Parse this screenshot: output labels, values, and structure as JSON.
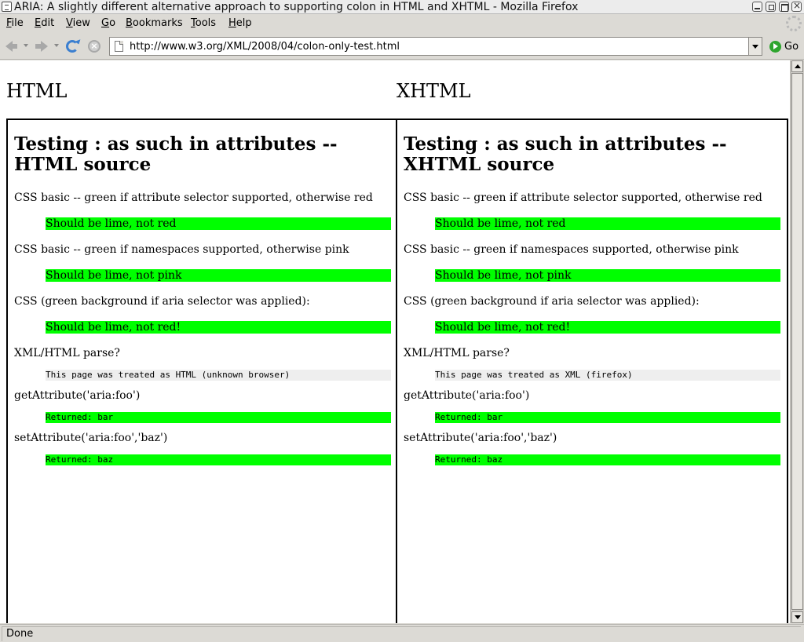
{
  "window": {
    "title": "ARIA: A slightly different alternative approach to supporting colon in HTML and XHTML - Mozilla Firefox"
  },
  "menu": [
    "File",
    "Edit",
    "View",
    "Go",
    "Bookmarks",
    "Tools",
    "Help"
  ],
  "navbar": {
    "url": "http://www.w3.org/XML/2008/04/colon-only-test.html",
    "go_label": "Go"
  },
  "page": {
    "col_html": "HTML",
    "col_xhtml": "XHTML",
    "left": {
      "heading": "Testing : as such in attributes -- HTML source",
      "css_basic_label": "CSS basic -- green if attribute selector supported, otherwise red",
      "css_basic_result": "Should be lime, not red",
      "css_ns_label": "CSS basic -- green if namespaces supported, otherwise pink",
      "css_ns_result": "Should be lime, not pink",
      "css_aria_label": "CSS (green background if aria selector was applied):",
      "css_aria_result": "Should be lime, not red!",
      "parse_label": "XML/HTML parse?",
      "parse_result": "This page was treated as HTML (unknown browser)",
      "get_label": "getAttribute('aria:foo')",
      "get_result": "Returned: bar",
      "set_label": "setAttribute('aria:foo','baz')",
      "set_result": "Returned: baz"
    },
    "right": {
      "heading": "Testing : as such in attributes -- XHTML source",
      "css_basic_label": "CSS basic -- green if attribute selector supported, otherwise red",
      "css_basic_result": "Should be lime, not red",
      "css_ns_label": "CSS basic -- green if namespaces supported, otherwise pink",
      "css_ns_result": "Should be lime, not pink",
      "css_aria_label": "CSS (green background if aria selector was applied):",
      "css_aria_result": "Should be lime, not red!",
      "parse_label": "XML/HTML parse?",
      "parse_result": "This page was treated as XML (firefox)",
      "get_label": "getAttribute('aria:foo')",
      "get_result": "Returned: bar",
      "set_label": "setAttribute('aria:foo','baz')",
      "set_result": "Returned: baz"
    }
  },
  "status": {
    "text": "Done"
  },
  "colors": {
    "lime": "#00ff00",
    "parse_bg": "#eeeeee",
    "chrome": "#dcdad5"
  }
}
